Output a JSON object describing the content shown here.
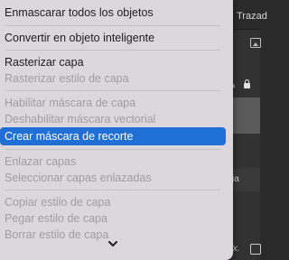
{
  "menu": {
    "items": [
      {
        "label": "Enmascarar todos los objetos",
        "enabled": true
      },
      {
        "label": "Convertir en objeto inteligente",
        "enabled": true
      },
      {
        "label": "Rasterizar capa",
        "enabled": true
      },
      {
        "label": "Rasterizar estilo de capa",
        "enabled": false
      },
      {
        "label": "Habilitar máscara de capa",
        "enabled": false
      },
      {
        "label": "Deshabilitar máscara vectorial",
        "enabled": false
      },
      {
        "label": "Crear máscara de recorte",
        "enabled": true,
        "selected": true
      },
      {
        "label": "Enlazar capas",
        "enabled": false
      },
      {
        "label": "Seleccionar capas enlazadas",
        "enabled": false
      },
      {
        "label": "Copiar estilo de capa",
        "enabled": false
      },
      {
        "label": "Pegar estilo de capa",
        "enabled": false
      },
      {
        "label": "Borrar estilo de capa",
        "enabled": false
      }
    ],
    "scroll_indicator_icon": "chevron-down-icon"
  },
  "background": {
    "tab_label": "Trazad",
    "layer_text": "cia",
    "fx_label": "fx."
  },
  "colors": {
    "menu_bg": "#dcd7dc",
    "selection": "#1f6fd6",
    "text": "#1d1d1d",
    "disabled_text": "#a09ca1"
  }
}
